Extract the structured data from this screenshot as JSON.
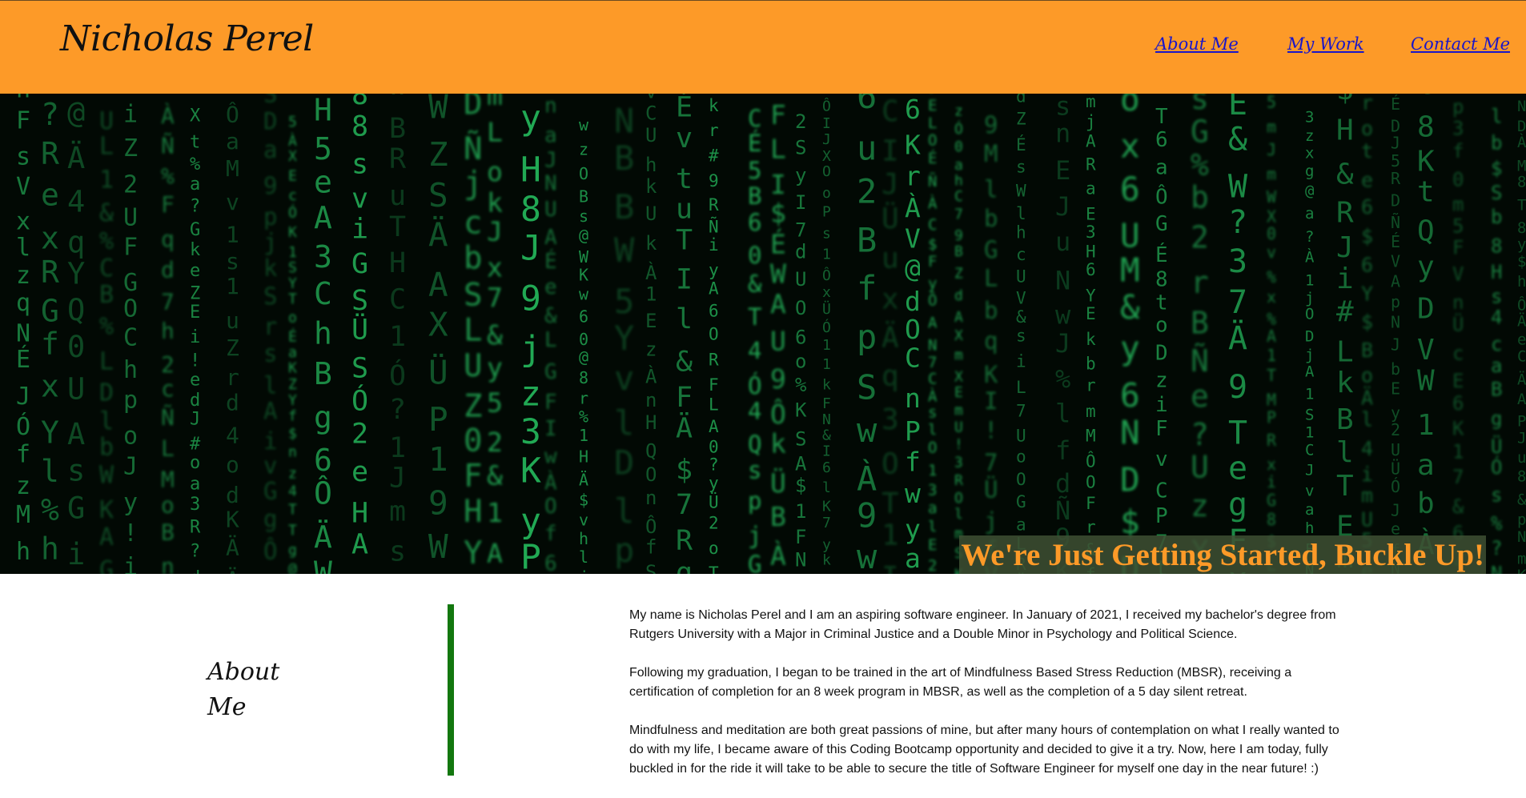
{
  "header": {
    "brand": "Nicholas Perel",
    "nav": [
      {
        "label": "About Me"
      },
      {
        "label": "My Work"
      },
      {
        "label": "Contact Me"
      }
    ],
    "background_color": "#fd9a28",
    "link_color": "#1a16c9"
  },
  "hero": {
    "image": "matrix-code-rain-image",
    "tagline": "We're Just Getting Started, Buckle Up!",
    "tagline_color": "#fd9a28",
    "code_color": "#28c864"
  },
  "about": {
    "heading": "About Me",
    "accent_color": "#13770f",
    "paragraphs": [
      "My name is Nicholas Perel and I am an aspiring software engineer. In January of 2021, I received my bachelor's degree from Rutgers University with a Major in Criminal Justice and a Double Minor in Psychology and Political Science.",
      "Following my graduation, I began to be trained in the art of Mindfulness Based Stress Reduction (MBSR), receiving a certification of completion for an 8 week program in MBSR, as well as the completion of a 5 day silent retreat.",
      "Mindfulness and meditation are both great passions of mine, but after many hours of contemplation on what I really wanted to do with my life, I became aware of this Coding Bootcamp opportunity and decided to give it a try. Now, here I am today, fully buckled in for the ride it will take to be able to secure the title of Software Engineer for myself one day in the near future! :)"
    ]
  }
}
